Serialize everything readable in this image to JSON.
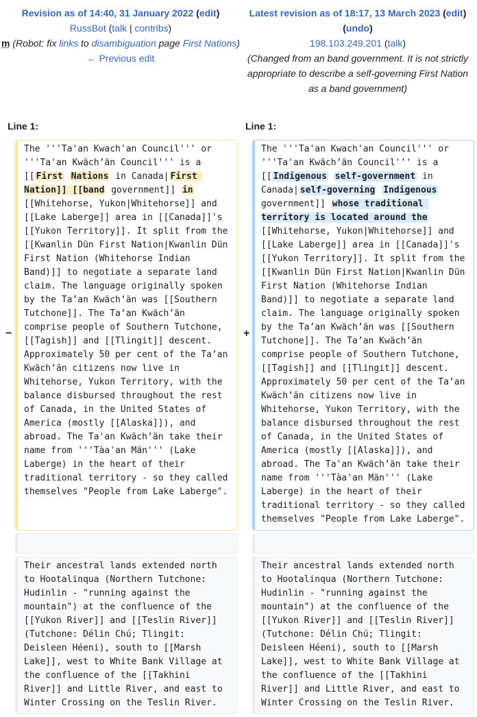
{
  "left_header": {
    "title_prefix": "Revision as of 14:40, 31 January 2022",
    "edit": "edit",
    "user": "RussBot",
    "talk": "talk",
    "contribs": "contribs",
    "minor_flag": "m",
    "summary_1": "(Robot: fix ",
    "summary_links": "links",
    "summary_2": " to ",
    "summary_disambig": "disambiguation",
    "summary_3": " page ",
    "summary_page": "First Nations",
    "summary_4": ")",
    "previous_edit": "← Previous edit"
  },
  "right_header": {
    "title_prefix": "Latest revision as of 18:17, 13 March 2023",
    "edit": "edit",
    "undo": "undo",
    "user": "198.103.249.201",
    "talk": "talk",
    "summary": "(Changed from an band government. It is not strictly appropriate to describe a self-governing First Nation as a band government)"
  },
  "line_label_left": "Line 1:",
  "line_label_right": "Line 1:",
  "minus": "−",
  "plus": "+",
  "left_para1": {
    "t1": "The '''Ta'an Kwach'an Council''' or '''Ta'an Kwäch’än Council''' is a [[",
    "h1": "First",
    "h2": "Nations",
    "t2": " in Canada|",
    "h3": "First Nation]] [[band",
    "t3": " government]] ",
    "h4": "in",
    "t4": " [[Whitehorse, Yukon|Whitehorse]] and [[Lake Laberge]] area in [[Canada]]'s [[Yukon Territory]]. It split from the [[Kwanlin Dün First Nation|Kwanlin Dün First Nation (Whitehorse Indian Band)]] to negotiate a separate land claim. The language originally spoken by the Ta’an Kwäch’än was [[Southern Tutchone]]. The Ta’an Kwäch’än comprise people of Southern Tutchone, [[Tagish]] and [[Tlingit]] descent. Approximately 50 per cent of the Ta’an Kwäch’än citizens now live in Whitehorse, Yukon Territory, with the balance disbursed throughout the rest of Canada, in the United States of America (mostly [[Alaska]]), and abroad. The Ta'an Kwäch’än take their name from '''Tàa'an Män''' (Lake Laberge) in the heart of their traditional territory - so they called themselves \"People from Lake Laberge\"."
  },
  "right_para1": {
    "t1": "The '''Ta'an Kwach'an Council''' or '''Ta'an Kwäch’än Council''' is a [[",
    "h1": "Indigenous",
    "h2": "self-government",
    "t2": " in Canada|",
    "h3": "self-governing",
    "h4": "Indigenous",
    "t3": " government]] ",
    "h5": "whose traditional territory is located around the",
    "t4": " [[Whitehorse, Yukon|Whitehorse]] and [[Lake Laberge]] area in [[Canada]]'s [[Yukon Territory]]. It split from the [[Kwanlin Dün First Nation|Kwanlin Dün First Nation (Whitehorse Indian Band)]] to negotiate a separate land claim. The language originally spoken by the Ta’an Kwäch’än was [[Southern Tutchone]]. The Ta’an Kwäch’än comprise people of Southern Tutchone, [[Tagish]] and [[Tlingit]] descent. Approximately 50 per cent of the Ta’an Kwäch’än citizens now live in Whitehorse, Yukon Territory, with the balance disbursed throughout the rest of Canada, in the United States of America (mostly [[Alaska]]), and abroad. The Ta'an Kwäch’än take their name from '''Tàa'an Män''' (Lake Laberge) in the heart of their traditional territory - so they called themselves \"People from Lake Laberge\"."
  },
  "context_para2": "Their ancestral lands extended north to Hootalinqua (Northern Tutchone: Hudinlin - \"running against the mountain\") at the confluence of the [[Yukon River]] and [[Teslin River]] (Tutchone: Délin Chú; Tlingit: Deisleen Héeni), south to [[Marsh Lake]], west to White Bank Village at the confluence of the [[Takhini River]] and Little River, and east to Winter Crossing on the Teslin River."
}
